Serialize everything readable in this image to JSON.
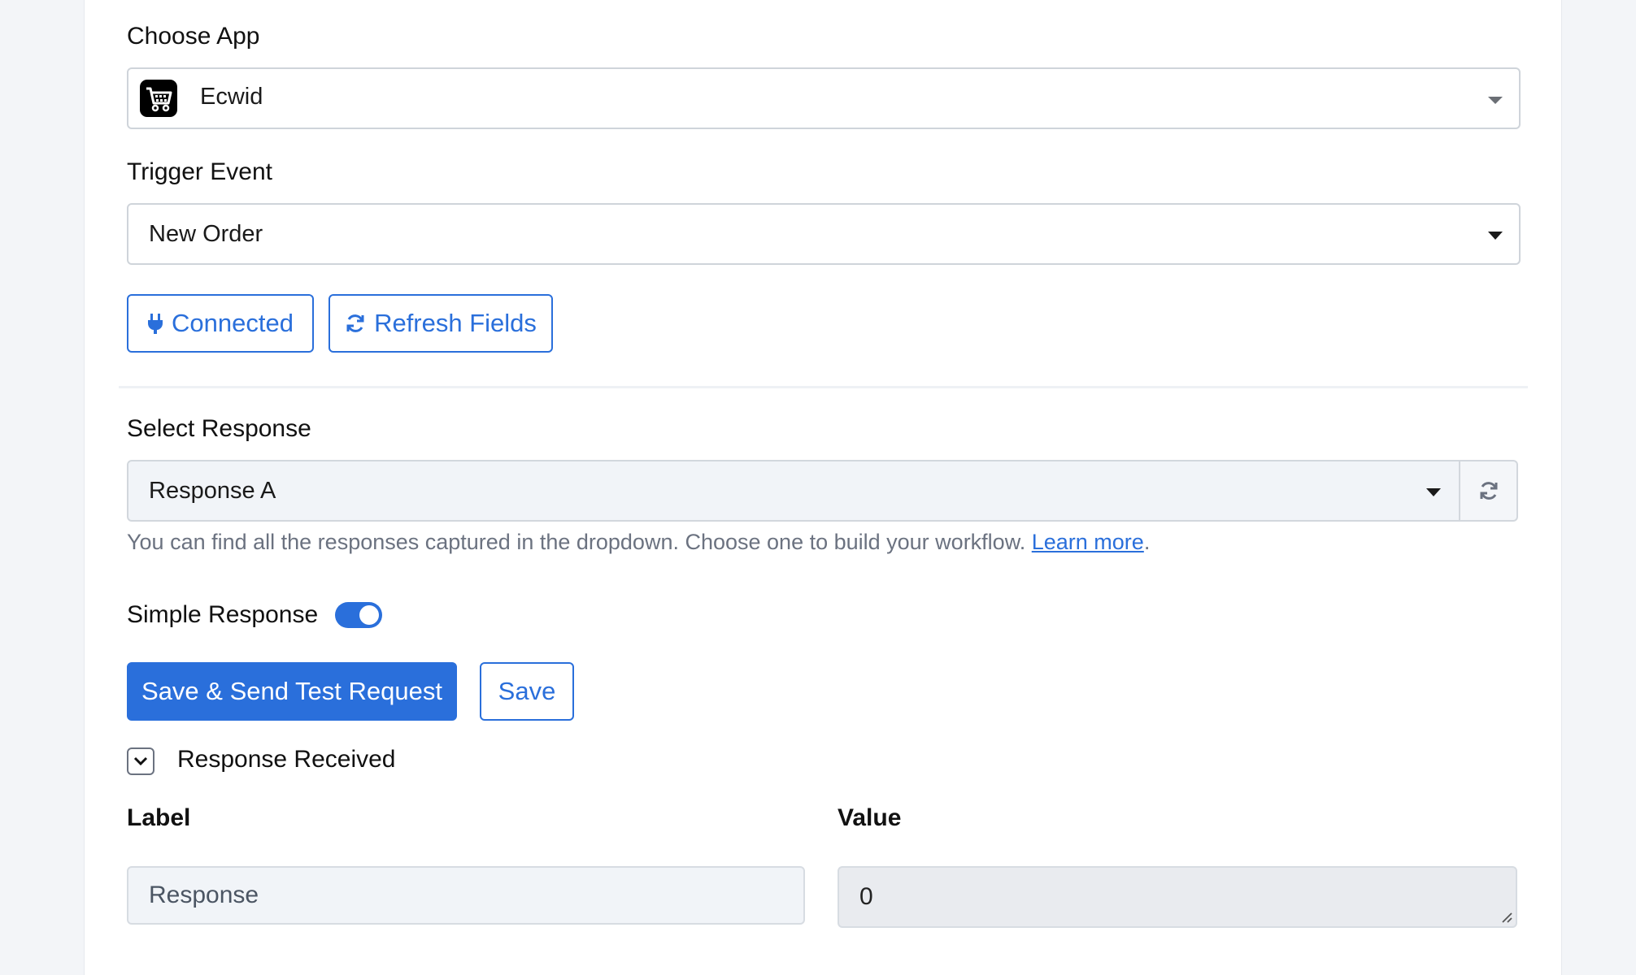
{
  "choose_app": {
    "label": "Choose App",
    "selected": "Ecwid",
    "icon": "ecwid-cart-icon"
  },
  "trigger_event": {
    "label": "Trigger Event",
    "selected": "New Order"
  },
  "buttons": {
    "connected": "Connected",
    "refresh_fields": "Refresh Fields",
    "save_send": "Save & Send Test Request",
    "save": "Save"
  },
  "select_response": {
    "label": "Select Response",
    "selected": "Response A",
    "hint_text": "You can find all the responses captured in the dropdown. Choose one to build your workflow.",
    "hint_link": "Learn more",
    "hint_end": "."
  },
  "simple_response": {
    "label": "Simple Response",
    "enabled": true
  },
  "response_received": {
    "label": "Response Received"
  },
  "mapping": {
    "label_header": "Label",
    "value_header": "Value",
    "label_value": "Response",
    "value_value": "0"
  },
  "colors": {
    "primary": "#2a6fdb",
    "background": "#f3f5f8",
    "card": "#ffffff"
  }
}
